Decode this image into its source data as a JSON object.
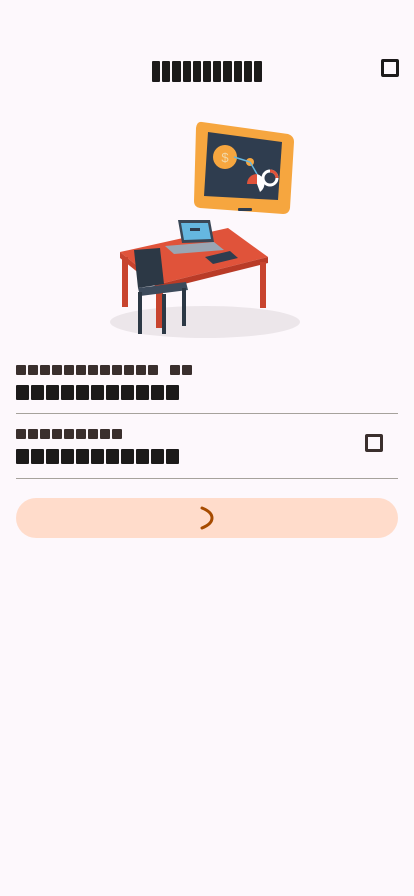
{
  "header": {
    "title_obscured_char_count": 11,
    "close_icon": "close-square-icon"
  },
  "illustration": {
    "name": "workspace-illustration",
    "colors": {
      "monitor": "#f6a63f",
      "screen": "#2f3d4f",
      "desk": "#e0533a",
      "chair": "#2c3845",
      "laptop": "#65b7e0"
    }
  },
  "field_one": {
    "label_char_count": 12,
    "label_suffix_char_count": 2,
    "value_char_count": 11
  },
  "field_two": {
    "label_char_count": 9,
    "value_char_count": 11,
    "toggle_icon": "visibility-toggle-icon"
  },
  "primary_action": {
    "state": "loading",
    "spinner_color": "#a64b00",
    "background": "#ffdccb"
  }
}
